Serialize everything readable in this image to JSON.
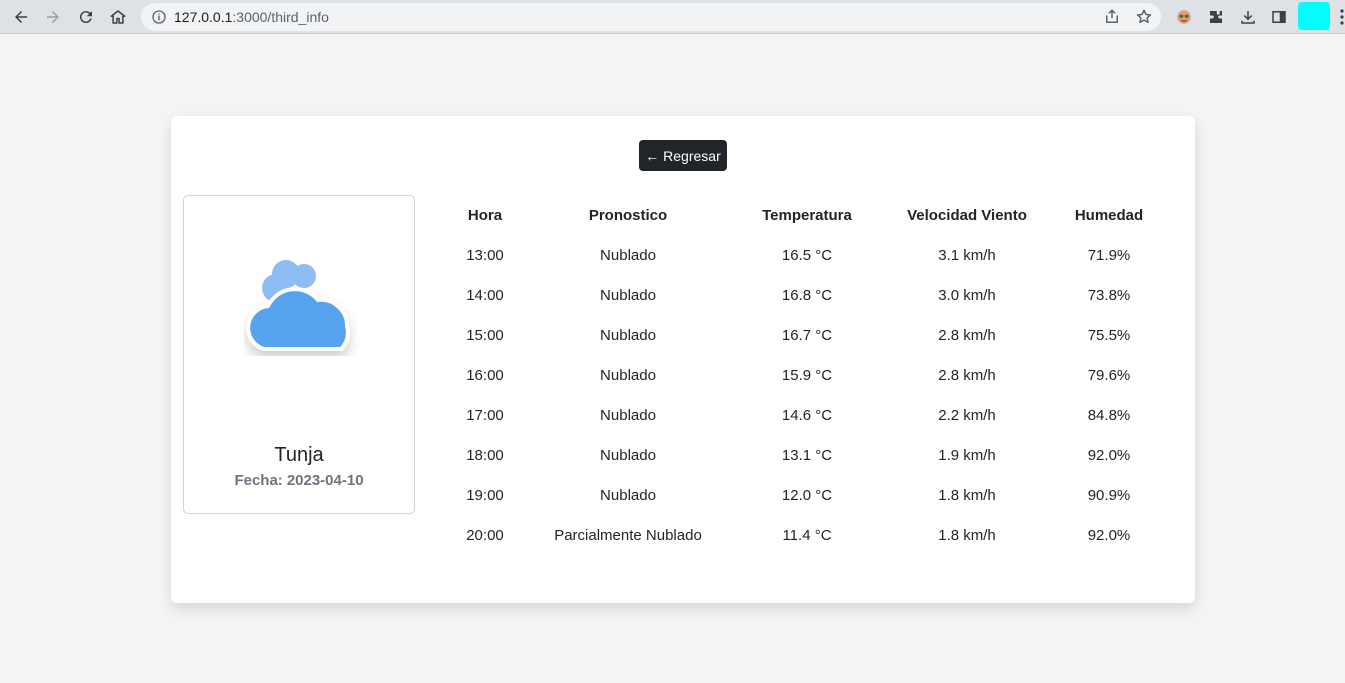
{
  "browser": {
    "url_host": "127.0.0.1",
    "url_path": ":3000/third_info",
    "colors": {
      "profile_tile": "#00ffff"
    }
  },
  "page": {
    "back_label": "← Regresar",
    "city": "Tunja",
    "date_label": "Fecha:",
    "date_value": "2023-04-10",
    "icon": "cloudy-weather-icon",
    "table": {
      "headers": [
        "Hora",
        "Pronostico",
        "Temperatura",
        "Velocidad Viento",
        "Humedad"
      ],
      "rows": [
        [
          "13:00",
          "Nublado",
          "16.5 °C",
          "3.1 km/h",
          "71.9%"
        ],
        [
          "14:00",
          "Nublado",
          "16.8 °C",
          "3.0 km/h",
          "73.8%"
        ],
        [
          "15:00",
          "Nublado",
          "16.7 °C",
          "2.8 km/h",
          "75.5%"
        ],
        [
          "16:00",
          "Nublado",
          "15.9 °C",
          "2.8 km/h",
          "79.6%"
        ],
        [
          "17:00",
          "Nublado",
          "14.6 °C",
          "2.2 km/h",
          "84.8%"
        ],
        [
          "18:00",
          "Nublado",
          "13.1 °C",
          "1.9 km/h",
          "92.0%"
        ],
        [
          "19:00",
          "Nublado",
          "12.0 °C",
          "1.8 km/h",
          "90.9%"
        ],
        [
          "20:00",
          "Parcialmente Nublado",
          "11.4 °C",
          "1.8 km/h",
          "92.0%"
        ]
      ]
    },
    "colors": {
      "button_bg": "#212529",
      "cloud": "#58a3ee",
      "cloud_light": "#8ebdf4"
    }
  }
}
